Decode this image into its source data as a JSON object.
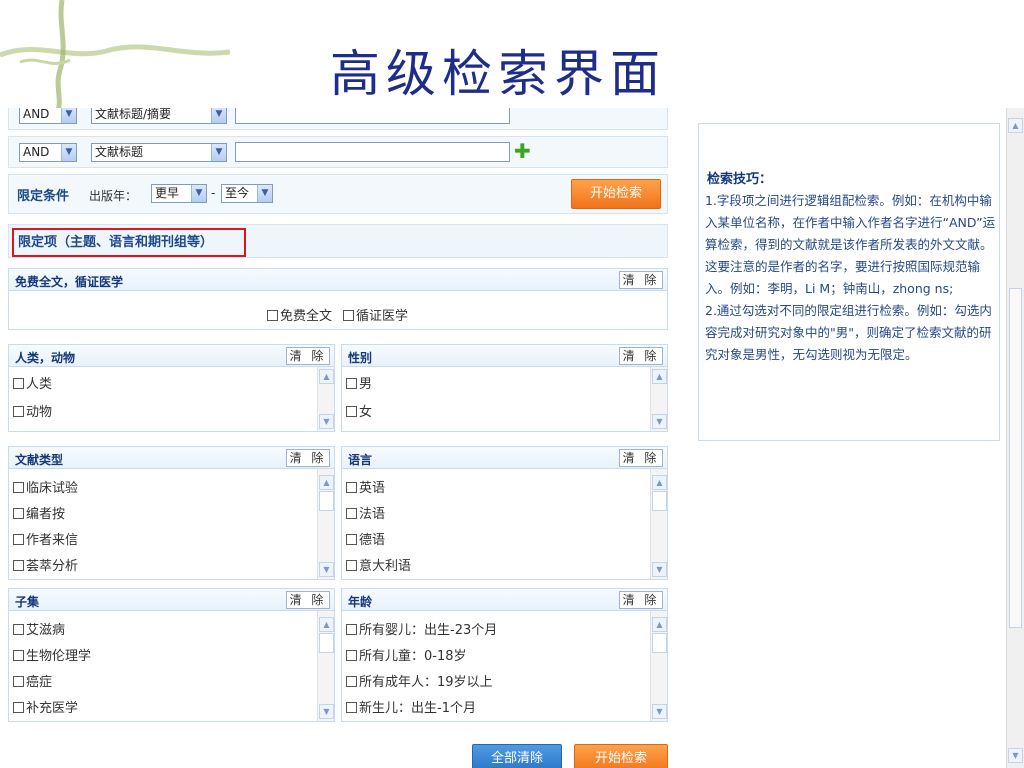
{
  "slide": {
    "title": "高级检索界面"
  },
  "search_rows": [
    {
      "operator": "AND",
      "field": "文献标题/摘要"
    },
    {
      "operator": "AND",
      "field": "文献标题"
    }
  ],
  "limits": {
    "label": "限定条件",
    "year_label": "出版年：",
    "year_from": "更早",
    "dash": "-",
    "year_to": "至今",
    "search_button": "开始检索",
    "section_label": "限定项（主题、语言和期刊组等）"
  },
  "panels": {
    "free": {
      "title": "免费全文，循证医学",
      "clear": "清 除",
      "items": [
        "免费全文",
        "循证医学"
      ]
    },
    "species": {
      "title": "人类，动物",
      "clear": "清 除",
      "items": [
        "人类",
        "动物"
      ]
    },
    "gender": {
      "title": "性别",
      "clear": "清 除",
      "items": [
        "男",
        "女"
      ]
    },
    "doctype": {
      "title": "文献类型",
      "clear": "清 除",
      "items": [
        "临床试验",
        "编者按",
        "作者来信",
        "荟萃分析"
      ]
    },
    "language": {
      "title": "语言",
      "clear": "清 除",
      "items": [
        "英语",
        "法语",
        "德语",
        "意大利语"
      ]
    },
    "subset": {
      "title": "子集",
      "clear": "清 除",
      "items": [
        "艾滋病",
        "生物伦理学",
        "癌症",
        "补充医学"
      ]
    },
    "age": {
      "title": "年龄",
      "clear": "清 除",
      "items": [
        "所有婴儿：出生-23个月",
        "所有儿童：0-18岁",
        "所有成年人：19岁以上",
        "新生儿：出生-1个月"
      ]
    }
  },
  "bottom": {
    "clear_all": "全部清除",
    "search": "开始检索"
  },
  "tips": {
    "title": "检索技巧：",
    "p1": "1.字段项之间进行逻辑组配检索。例如：在机构中输入某单位名称，在作者中输入作者名字进行“AND”运算检索，得到的文献就是该作者所发表的外文文献。这要注意的是作者的名字，要进行按照国际规范输入。例如：李明，Li M；钟南山，zhong ns;",
    "p2": "2.通过勾选对不同的限定组进行检索。例如：勾选内容完成对研究对象中的\"男\"，则确定了检索文献的研究对象是男性，无勾选则视为无限定。"
  },
  "colors": {
    "accent_orange": "#f0731a",
    "accent_blue": "#2a73c7",
    "title_blue": "#1f2d8a",
    "highlight_red": "#e0141e"
  }
}
